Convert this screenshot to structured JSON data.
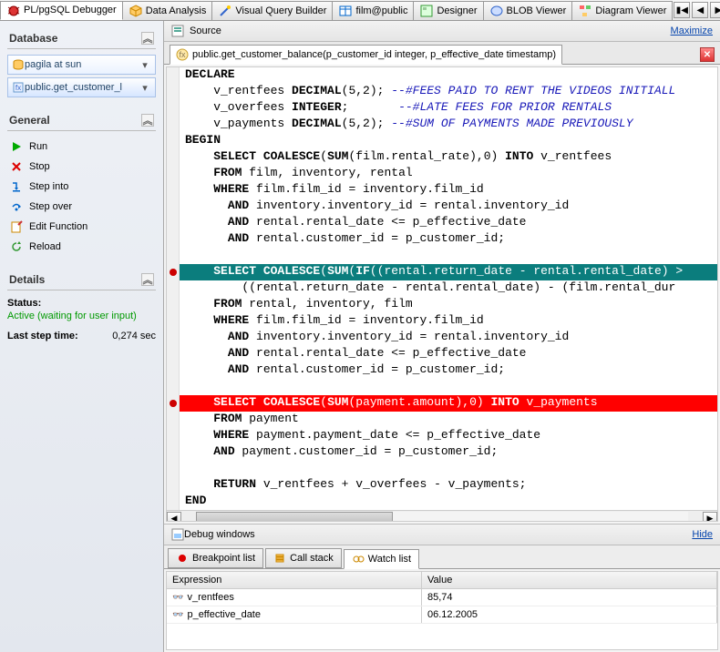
{
  "top_tabs": [
    {
      "label": "PL/pgSQL Debugger",
      "icon": "bug-icon",
      "active": true
    },
    {
      "label": "Data Analysis",
      "icon": "cube-icon"
    },
    {
      "label": "Visual Query Builder",
      "icon": "wand-icon"
    },
    {
      "label": "film@public",
      "icon": "table-icon"
    },
    {
      "label": "Designer",
      "icon": "designer-icon"
    },
    {
      "label": "BLOB Viewer",
      "icon": "blob-icon"
    },
    {
      "label": "Diagram Viewer",
      "icon": "diagram-icon"
    }
  ],
  "sidebar": {
    "database": {
      "title": "Database",
      "items": [
        {
          "label": "pagila at sun",
          "icon": "db-icon"
        },
        {
          "label": "public.get_customer_l",
          "icon": "fn-icon"
        }
      ]
    },
    "general": {
      "title": "General",
      "items": [
        {
          "label": "Run",
          "icon": "run-icon"
        },
        {
          "label": "Stop",
          "icon": "stop-icon"
        },
        {
          "label": "Step into",
          "icon": "stepinto-icon"
        },
        {
          "label": "Step over",
          "icon": "stepover-icon"
        },
        {
          "label": "Edit Function",
          "icon": "edit-icon"
        },
        {
          "label": "Reload",
          "icon": "reload-icon"
        }
      ]
    },
    "details": {
      "title": "Details",
      "status_label": "Status:",
      "status_value": "Active (waiting for user input)",
      "last_step_label": "Last step time:",
      "last_step_value": "0,274 sec"
    }
  },
  "source": {
    "header": "Source",
    "maximize": "Maximize",
    "function_sig": "public.get_customer_balance(p_customer_id integer, p_effective_date timestamp)"
  },
  "code": [
    {
      "t": "DECLARE",
      "cls": "kw",
      "ind": 0
    },
    {
      "raw": [
        {
          "t": "    v_rentfees ",
          "c": ""
        },
        {
          "t": "DECIMAL",
          "c": "kw"
        },
        {
          "t": "(5,2); ",
          "c": ""
        },
        {
          "t": "--#FEES PAID TO RENT THE VIDEOS INITIALL",
          "c": "cmt"
        }
      ]
    },
    {
      "raw": [
        {
          "t": "    v_overfees ",
          "c": ""
        },
        {
          "t": "INTEGER",
          "c": "kw"
        },
        {
          "t": ";       ",
          "c": ""
        },
        {
          "t": "--#LATE FEES FOR PRIOR RENTALS",
          "c": "cmt"
        }
      ]
    },
    {
      "raw": [
        {
          "t": "    v_payments ",
          "c": ""
        },
        {
          "t": "DECIMAL",
          "c": "kw"
        },
        {
          "t": "(5,2); ",
          "c": ""
        },
        {
          "t": "--#SUM OF PAYMENTS MADE PREVIOUSLY",
          "c": "cmt"
        }
      ]
    },
    {
      "t": "BEGIN",
      "cls": "kw",
      "ind": 0
    },
    {
      "raw": [
        {
          "t": "    ",
          "c": ""
        },
        {
          "t": "SELECT COALESCE",
          "c": "kw"
        },
        {
          "t": "(",
          "c": ""
        },
        {
          "t": "SUM",
          "c": "kw"
        },
        {
          "t": "(film.rental_rate),0) ",
          "c": ""
        },
        {
          "t": "INTO",
          "c": "kw"
        },
        {
          "t": " v_rentfees",
          "c": ""
        }
      ]
    },
    {
      "raw": [
        {
          "t": "    ",
          "c": ""
        },
        {
          "t": "FROM",
          "c": "kw"
        },
        {
          "t": " film, inventory, rental",
          "c": ""
        }
      ]
    },
    {
      "raw": [
        {
          "t": "    ",
          "c": ""
        },
        {
          "t": "WHERE",
          "c": "kw"
        },
        {
          "t": " film.film_id = inventory.film_id",
          "c": ""
        }
      ]
    },
    {
      "raw": [
        {
          "t": "      ",
          "c": ""
        },
        {
          "t": "AND",
          "c": "kw"
        },
        {
          "t": " inventory.inventory_id = rental.inventory_id",
          "c": ""
        }
      ]
    },
    {
      "raw": [
        {
          "t": "      ",
          "c": ""
        },
        {
          "t": "AND",
          "c": "kw"
        },
        {
          "t": " rental.rental_date <= p_effective_date",
          "c": ""
        }
      ]
    },
    {
      "raw": [
        {
          "t": "      ",
          "c": ""
        },
        {
          "t": "AND",
          "c": "kw"
        },
        {
          "t": " rental.customer_id = p_customer_id;",
          "c": ""
        }
      ]
    },
    {
      "t": "",
      "ind": 0
    },
    {
      "hl": "teal",
      "bp": true,
      "raw": [
        {
          "t": "    ",
          "c": ""
        },
        {
          "t": "SELECT COALESCE",
          "c": "kw"
        },
        {
          "t": "(",
          "c": ""
        },
        {
          "t": "SUM",
          "c": "kw"
        },
        {
          "t": "(",
          "c": ""
        },
        {
          "t": "IF",
          "c": "kw"
        },
        {
          "t": "((rental.return_date - rental.rental_date) >",
          "c": ""
        }
      ]
    },
    {
      "raw": [
        {
          "t": "        ((rental.return_date - rental.rental_date) - (film.rental_dur",
          "c": ""
        }
      ]
    },
    {
      "raw": [
        {
          "t": "    ",
          "c": ""
        },
        {
          "t": "FROM",
          "c": "kw"
        },
        {
          "t": " rental, inventory, film",
          "c": ""
        }
      ]
    },
    {
      "raw": [
        {
          "t": "    ",
          "c": ""
        },
        {
          "t": "WHERE",
          "c": "kw"
        },
        {
          "t": " film.film_id = inventory.film_id",
          "c": ""
        }
      ]
    },
    {
      "raw": [
        {
          "t": "      ",
          "c": ""
        },
        {
          "t": "AND",
          "c": "kw"
        },
        {
          "t": " inventory.inventory_id = rental.inventory_id",
          "c": ""
        }
      ]
    },
    {
      "raw": [
        {
          "t": "      ",
          "c": ""
        },
        {
          "t": "AND",
          "c": "kw"
        },
        {
          "t": " rental.rental_date <= p_effective_date",
          "c": ""
        }
      ]
    },
    {
      "raw": [
        {
          "t": "      ",
          "c": ""
        },
        {
          "t": "AND",
          "c": "kw"
        },
        {
          "t": " rental.customer_id = p_customer_id;",
          "c": ""
        }
      ]
    },
    {
      "t": "",
      "ind": 0
    },
    {
      "hl": "red",
      "bp": true,
      "raw": [
        {
          "t": "    ",
          "c": ""
        },
        {
          "t": "SELECT COALESCE",
          "c": "kw"
        },
        {
          "t": "(",
          "c": ""
        },
        {
          "t": "SUM",
          "c": "kw"
        },
        {
          "t": "(payment.amount),0) ",
          "c": ""
        },
        {
          "t": "INTO",
          "c": "kw"
        },
        {
          "t": " v_payments",
          "c": ""
        }
      ]
    },
    {
      "raw": [
        {
          "t": "    ",
          "c": ""
        },
        {
          "t": "FROM",
          "c": "kw"
        },
        {
          "t": " payment",
          "c": ""
        }
      ]
    },
    {
      "raw": [
        {
          "t": "    ",
          "c": ""
        },
        {
          "t": "WHERE",
          "c": "kw"
        },
        {
          "t": " payment.payment_date <= p_effective_date",
          "c": ""
        }
      ]
    },
    {
      "raw": [
        {
          "t": "    ",
          "c": ""
        },
        {
          "t": "AND",
          "c": "kw"
        },
        {
          "t": " payment.customer_id = p_customer_id;",
          "c": ""
        }
      ]
    },
    {
      "t": "",
      "ind": 0
    },
    {
      "raw": [
        {
          "t": "    ",
          "c": ""
        },
        {
          "t": "RETURN",
          "c": "kw"
        },
        {
          "t": " v_rentfees + v_overfees - v_payments;",
          "c": ""
        }
      ]
    },
    {
      "t": "END",
      "cls": "kw",
      "ind": 0
    }
  ],
  "debug": {
    "header": "Debug windows",
    "hide": "Hide",
    "tabs": [
      {
        "label": "Breakpoint list",
        "icon": "bp-icon"
      },
      {
        "label": "Call stack",
        "icon": "stack-icon"
      },
      {
        "label": "Watch list",
        "icon": "watch-icon",
        "active": true
      }
    ],
    "watch": {
      "col1": "Expression",
      "col2": "Value",
      "rows": [
        {
          "expr": "v_rentfees",
          "val": "85,74"
        },
        {
          "expr": "p_effective_date",
          "val": "06.12.2005"
        }
      ]
    }
  }
}
